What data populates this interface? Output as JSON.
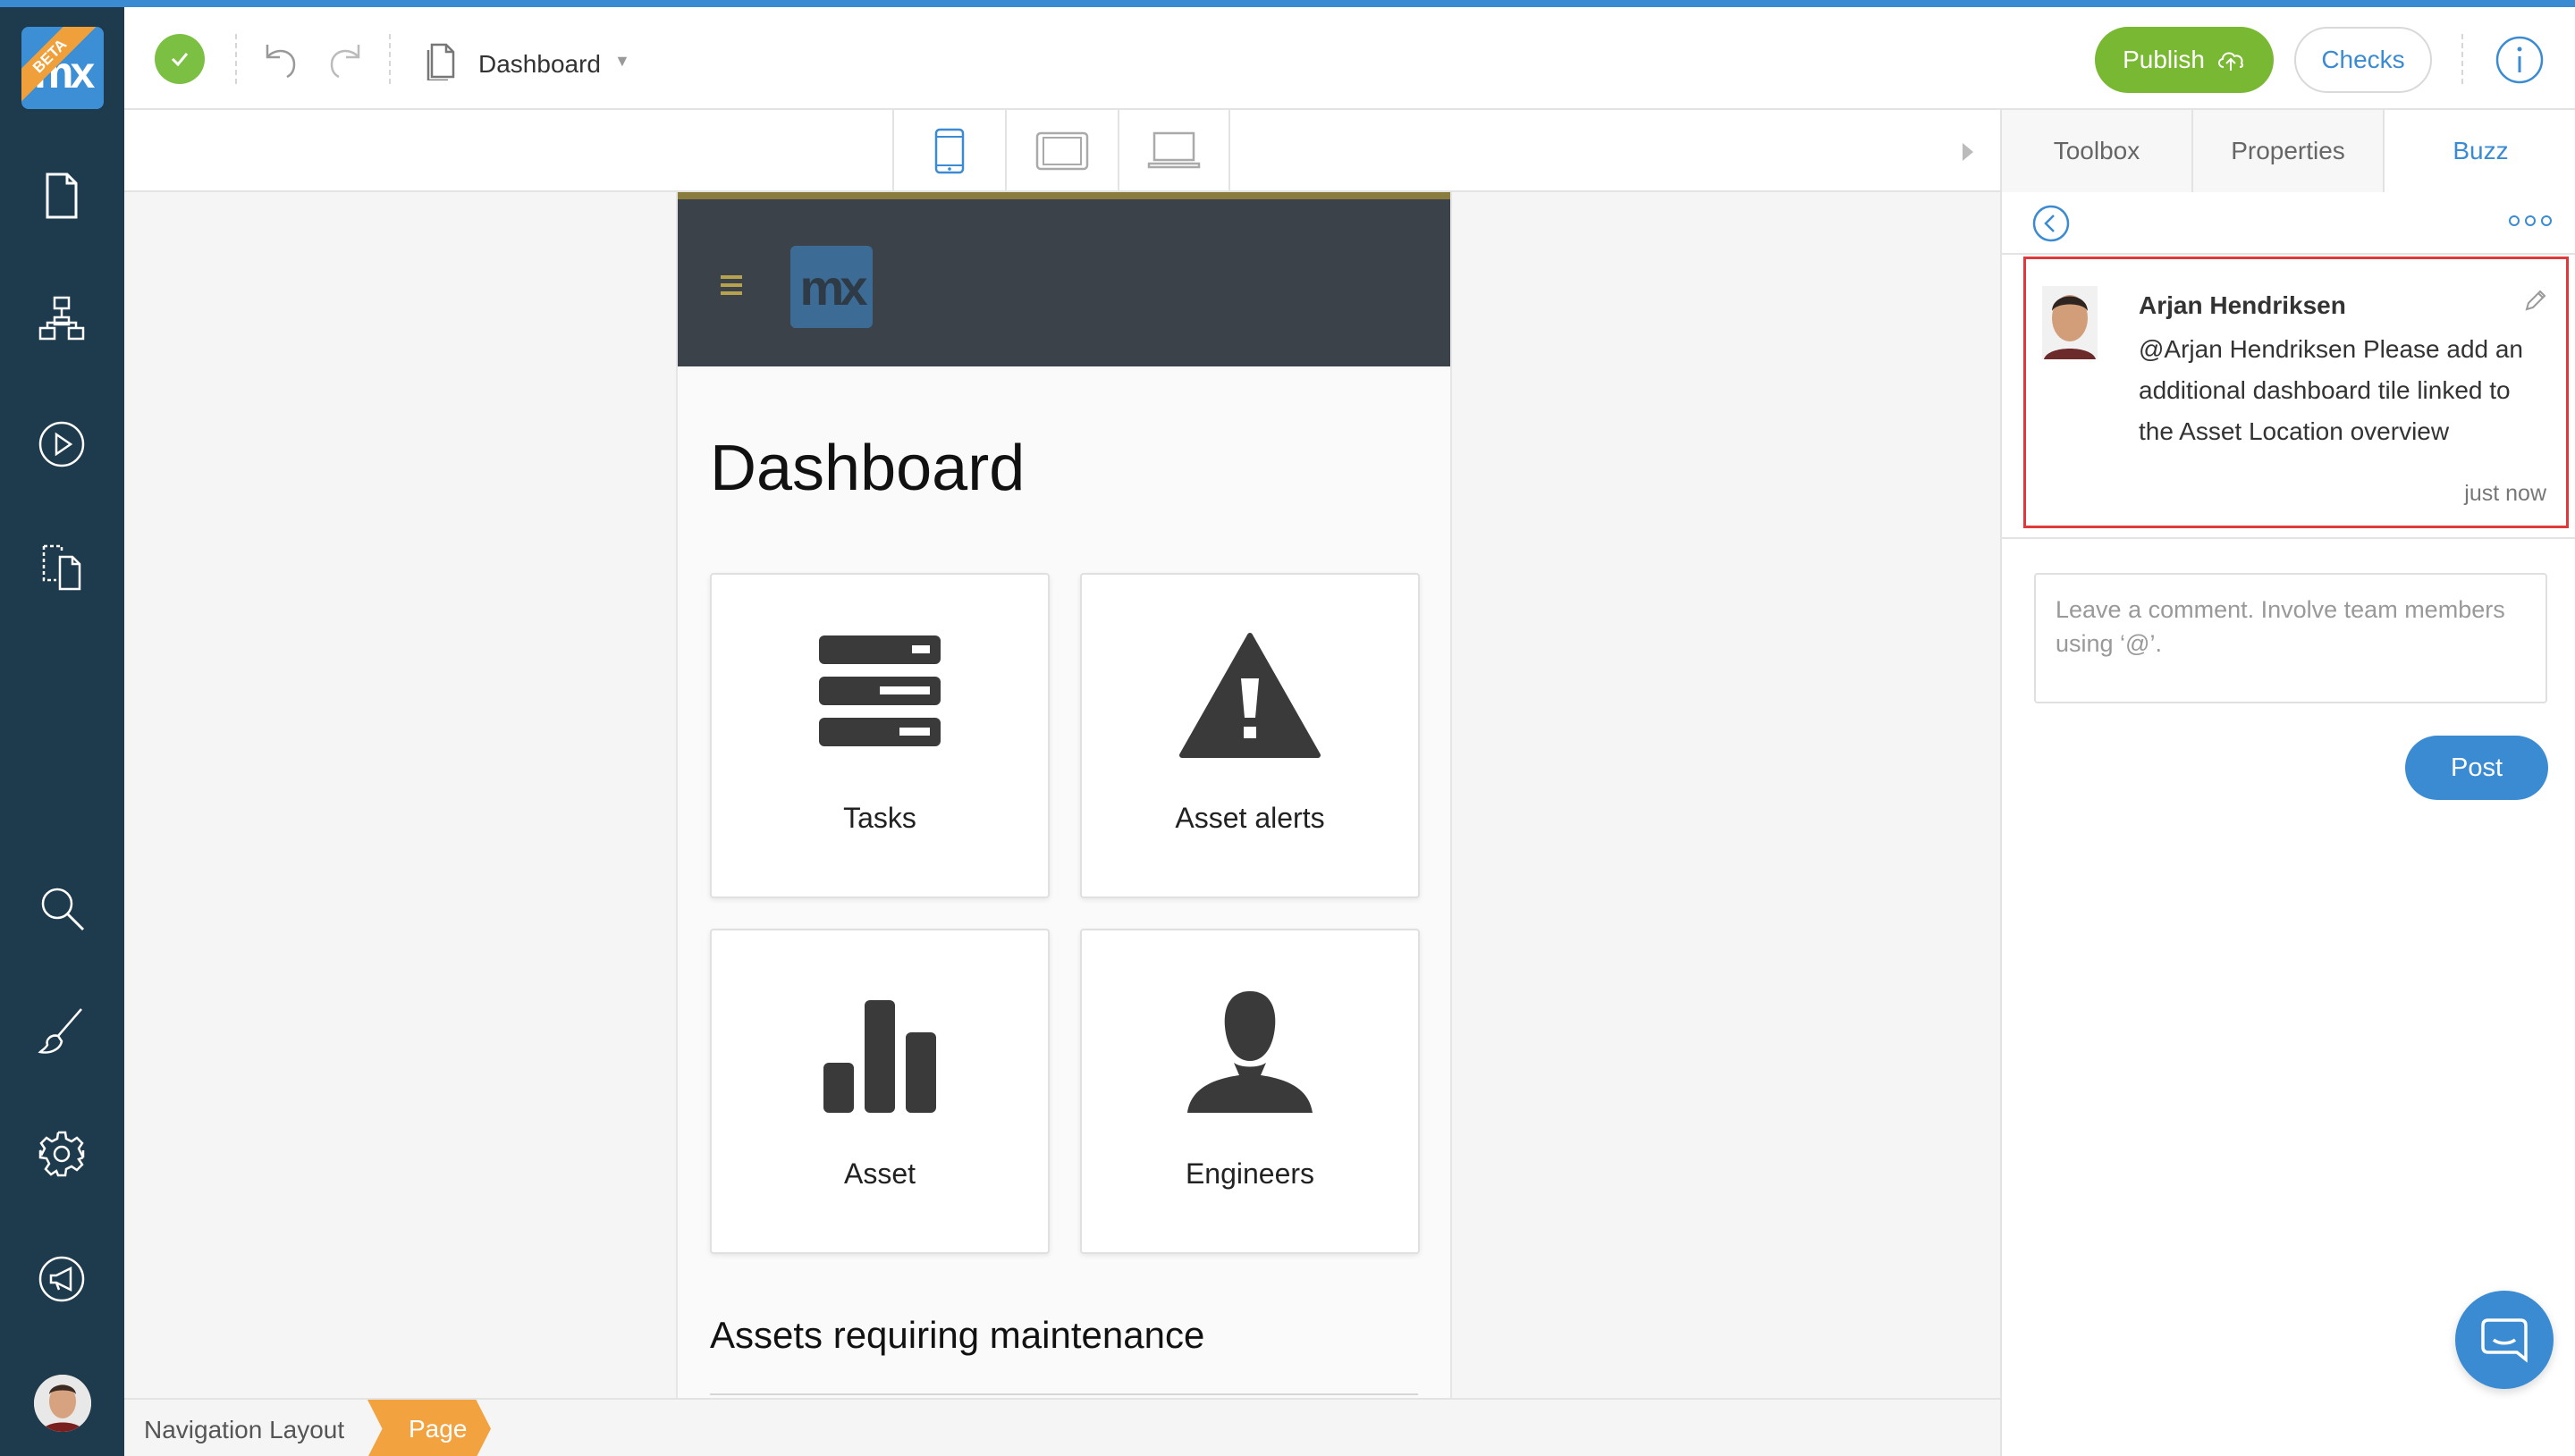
{
  "app": {
    "beta_badge": "BETA",
    "logo_text": "mx",
    "accent_color": "#3b8bd2",
    "success_color": "#7bc043"
  },
  "sidebar": {
    "items": [
      {
        "icon": "page-icon"
      },
      {
        "icon": "domain-model-icon"
      },
      {
        "icon": "run-icon"
      },
      {
        "icon": "app-explorer-icon"
      },
      {
        "icon": "search-icon"
      },
      {
        "icon": "brush-icon"
      },
      {
        "icon": "gear-icon"
      },
      {
        "icon": "megaphone-icon"
      }
    ],
    "user_avatar": "avatar"
  },
  "toolbar": {
    "document_title": "Dashboard",
    "publish_label": "Publish",
    "checks_label": "Checks"
  },
  "device_bar": {
    "devices": [
      "phone-icon",
      "tablet-icon",
      "desktop-icon"
    ],
    "active_device": "phone"
  },
  "page": {
    "logo_text": "mx",
    "title": "Dashboard",
    "tiles": [
      {
        "label": "Tasks",
        "icon": "server-icon"
      },
      {
        "label": "Asset alerts",
        "icon": "warning-icon"
      },
      {
        "label": "Asset",
        "icon": "bar-chart-icon"
      },
      {
        "label": "Engineers",
        "icon": "user-icon"
      }
    ],
    "section_title": "Assets requiring maintenance"
  },
  "breadcrumb": {
    "items": [
      "Navigation Layout",
      "Page"
    ]
  },
  "right_panel": {
    "tabs": [
      "Toolbox",
      "Properties",
      "Buzz"
    ],
    "active_tab": "Buzz",
    "comment": {
      "author": "Arjan Hendriksen",
      "text": "@Arjan Hendriksen Please add an additional dashboard tile linked to the Asset Location overview",
      "time": "just now"
    },
    "input_placeholder": "Leave a comment. Involve team members using ‘@’.",
    "post_label": "Post"
  }
}
